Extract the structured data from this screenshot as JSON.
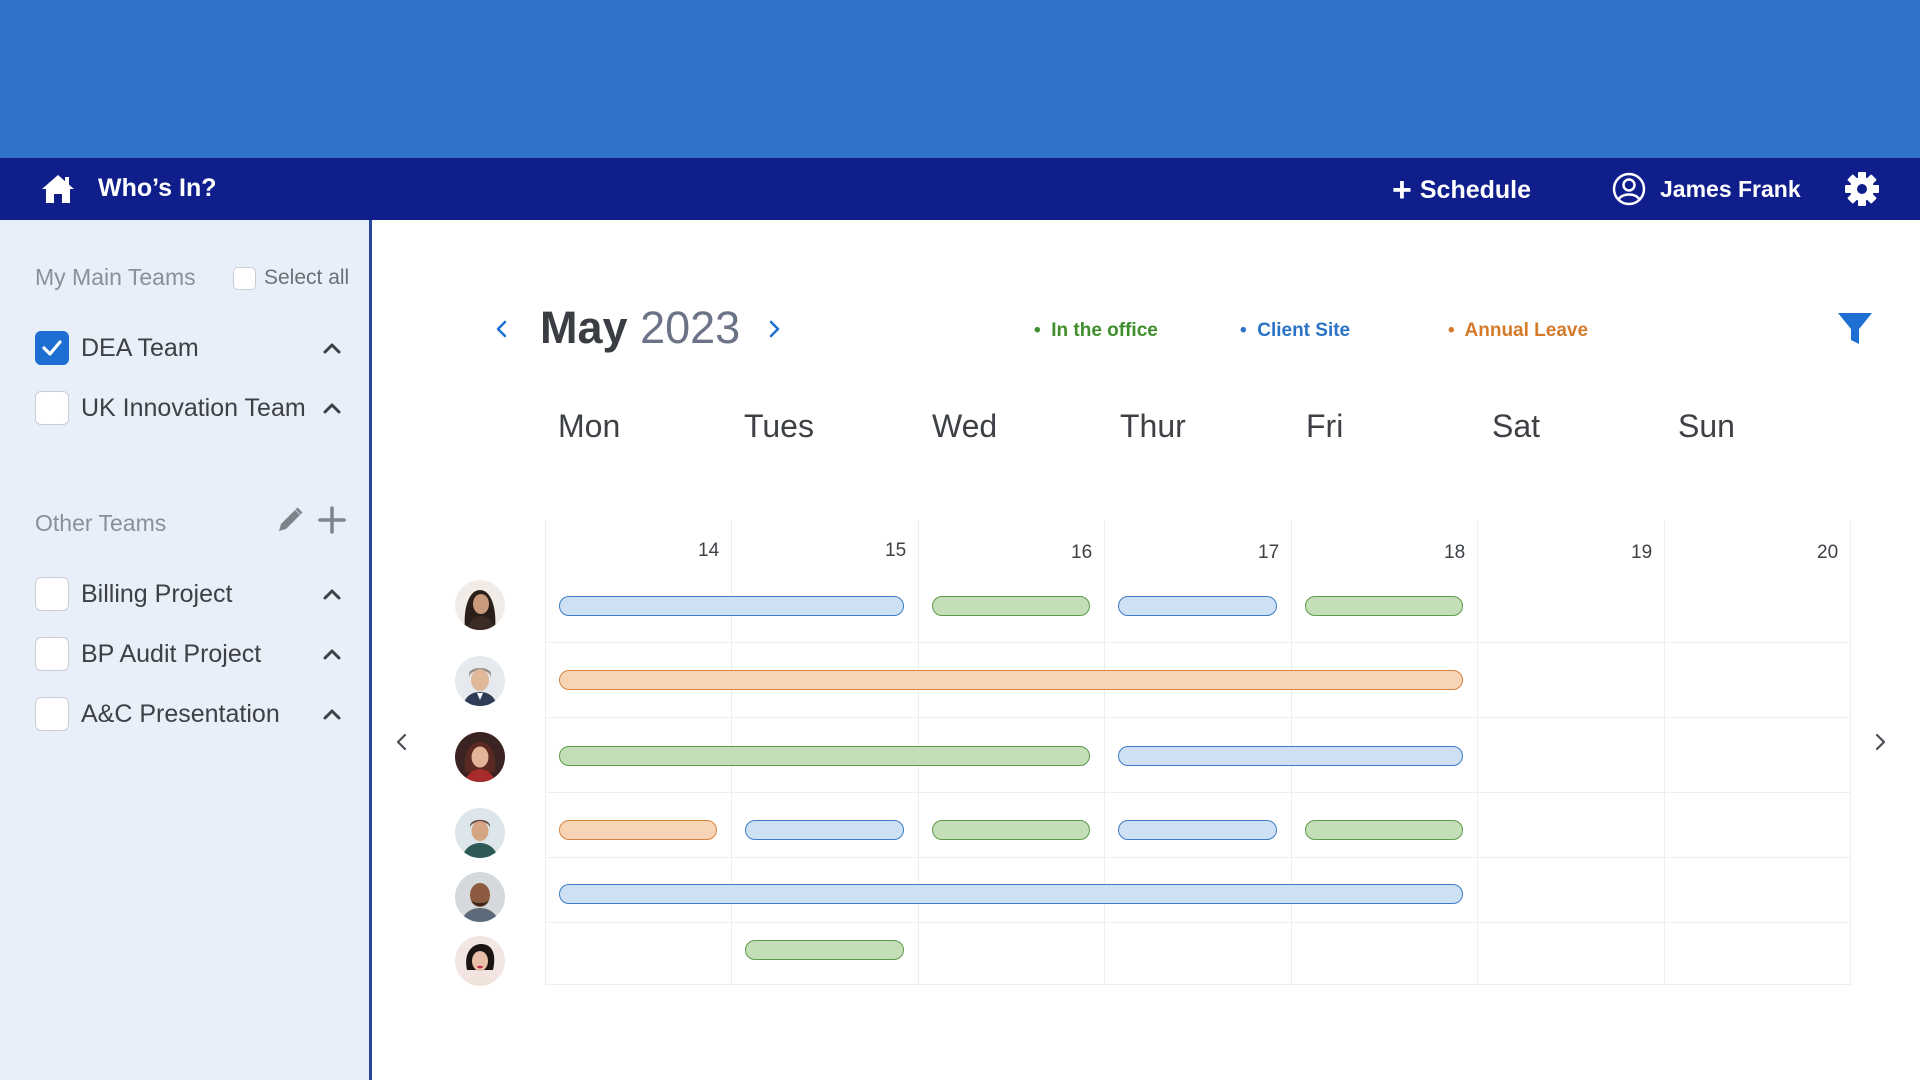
{
  "nav": {
    "title": "Who’s In?",
    "schedule_label": "Schedule",
    "user_name": "James Frank"
  },
  "sidebar": {
    "main_heading": "My Main Teams",
    "select_all_label": "Select all",
    "main_teams": [
      {
        "label": "DEA Team",
        "checked": true
      },
      {
        "label": "UK Innovation Team",
        "checked": false
      }
    ],
    "other_heading": "Other Teams",
    "other_teams": [
      {
        "label": "Billing Project",
        "checked": false
      },
      {
        "label": "BP Audit Project",
        "checked": false
      },
      {
        "label": "A&C Presentation",
        "checked": false
      }
    ]
  },
  "calendar": {
    "month": "May",
    "year": "2023",
    "legend": [
      {
        "label": "In the office",
        "color": "#3f8f2c"
      },
      {
        "label": "Client Site",
        "color": "#2a73c5"
      },
      {
        "label": "Annual Leave",
        "color": "#d57a2a"
      }
    ],
    "days": [
      {
        "name": "Mon",
        "date": "14"
      },
      {
        "name": "Tues",
        "date": "15"
      },
      {
        "name": "Wed",
        "date": "16"
      },
      {
        "name": "Thur",
        "date": "17"
      },
      {
        "name": "Fri",
        "date": "18"
      },
      {
        "name": "Sat",
        "date": "19"
      },
      {
        "name": "Sun",
        "date": "20"
      }
    ],
    "schedule_rows": [
      [
        {
          "start": 0,
          "span": 2,
          "type": "client"
        },
        {
          "start": 2,
          "span": 1,
          "type": "office"
        },
        {
          "start": 3,
          "span": 1,
          "type": "client"
        },
        {
          "start": 4,
          "span": 1,
          "type": "office"
        }
      ],
      [
        {
          "start": 0,
          "span": 5,
          "type": "leave"
        }
      ],
      [
        {
          "start": 0,
          "span": 3,
          "type": "office"
        },
        {
          "start": 3,
          "span": 2,
          "type": "client"
        }
      ],
      [
        {
          "start": 0,
          "span": 1,
          "type": "leave"
        },
        {
          "start": 1,
          "span": 1,
          "type": "client"
        },
        {
          "start": 2,
          "span": 1,
          "type": "office"
        },
        {
          "start": 3,
          "span": 1,
          "type": "client"
        },
        {
          "start": 4,
          "span": 1,
          "type": "office"
        }
      ],
      [
        {
          "start": 0,
          "span": 5,
          "type": "client"
        }
      ],
      [
        {
          "start": 1,
          "span": 1,
          "type": "office"
        }
      ]
    ]
  },
  "colors": {
    "banner": "#2e72ca",
    "navbar": "#101e8c",
    "sidebar_bg": "#e8eff9",
    "checkbox_checked": "#1e6fd1",
    "filter": "#1e6fd1"
  },
  "icons": [
    "home-icon",
    "plus-icon",
    "user-circle-icon",
    "gear-icon",
    "check-icon",
    "chevron-up-icon",
    "pencil-icon",
    "chevron-left-icon",
    "chevron-right-icon",
    "filter-icon"
  ]
}
